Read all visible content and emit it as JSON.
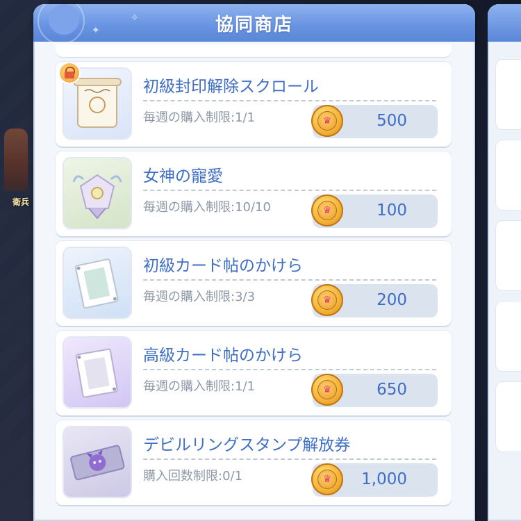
{
  "window": {
    "title": "協同商店"
  },
  "background": {
    "npc_label": "衛兵"
  },
  "currency_icon": "crown-coin-icon",
  "items": [
    {
      "name": "初級封印解除スクロール",
      "limit": "毎週の購入制限:1/1",
      "price": "500",
      "icon": "scroll-icon",
      "locked": true,
      "thumb_bg": "#e6eefb"
    },
    {
      "name": "女神の寵愛",
      "limit": "毎週の購入制限:10/10",
      "price": "100",
      "icon": "goddess-favor-icon",
      "locked": false,
      "thumb_bg": "#e8f0e1"
    },
    {
      "name": "初級カード帖のかけら",
      "limit": "毎週の購入制限:3/3",
      "price": "200",
      "icon": "card-fragment-icon",
      "locked": false,
      "thumb_bg": "#dfeaf8"
    },
    {
      "name": "高級カード帖のかけら",
      "limit": "毎週の購入制限:1/1",
      "price": "650",
      "icon": "card-fragment-purple-icon",
      "locked": false,
      "thumb_bg": "#e6defa"
    },
    {
      "name": "デビルリングスタンプ解放券",
      "limit": "購入回数制限:0/1",
      "price": "1,000",
      "icon": "devil-ticket-icon",
      "locked": false,
      "thumb_bg": "#dedcf0"
    }
  ],
  "colors": {
    "accent": "#3e6fc4",
    "header": "#6a95e2",
    "muted": "#8f98a7"
  }
}
